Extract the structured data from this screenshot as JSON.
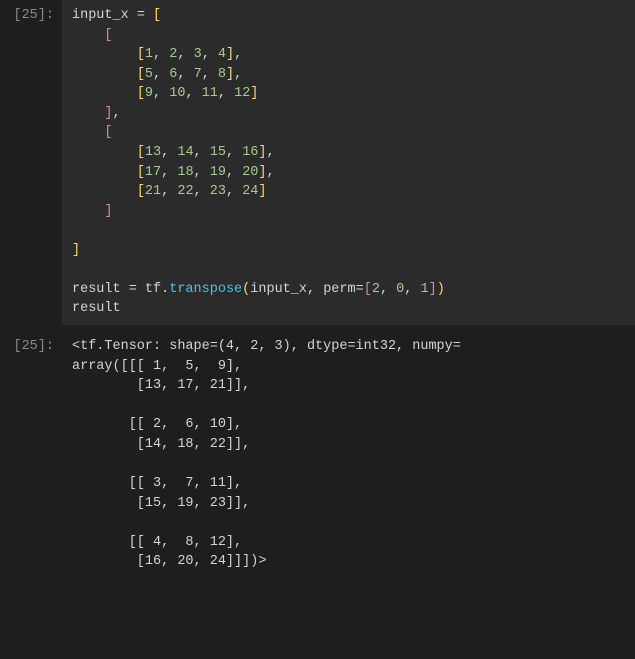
{
  "input_prompt": "[25]:",
  "output_prompt": "[25]:",
  "code": {
    "var_input": "input_x",
    "eq": " = ",
    "lb": "[",
    "rb": "]",
    "lp": "(",
    "rp": ")",
    "comma": ",",
    "sp4": "    ",
    "sp8": "        ",
    "row1": {
      "a": "1",
      "b": "2",
      "c": "3",
      "d": "4"
    },
    "row2": {
      "a": "5",
      "b": "6",
      "c": "7",
      "d": "8"
    },
    "row3": {
      "a": "9",
      "b": "10",
      "c": "11",
      "d": "12"
    },
    "row4": {
      "a": "13",
      "b": "14",
      "c": "15",
      "d": "16"
    },
    "row5": {
      "a": "17",
      "b": "18",
      "c": "19",
      "d": "20"
    },
    "row6": {
      "a": "21",
      "b": "22",
      "c": "23",
      "d": "24"
    },
    "var_result": "result",
    "tf": "tf",
    "dot": ".",
    "transpose": "transpose",
    "perm_kw": "perm",
    "perm0": "2",
    "perm1": "0",
    "perm2": "1"
  },
  "output_text": "<tf.Tensor: shape=(4, 2, 3), dtype=int32, numpy=\narray([[[ 1,  5,  9],\n        [13, 17, 21]],\n\n       [[ 2,  6, 10],\n        [14, 18, 22]],\n\n       [[ 3,  7, 11],\n        [15, 19, 23]],\n\n       [[ 4,  8, 12],\n        [16, 20, 24]]])>",
  "chart_data": {
    "type": "table",
    "input_tensor_shape": [
      2,
      3,
      4
    ],
    "input_tensor": [
      [
        [
          1,
          2,
          3,
          4
        ],
        [
          5,
          6,
          7,
          8
        ],
        [
          9,
          10,
          11,
          12
        ]
      ],
      [
        [
          13,
          14,
          15,
          16
        ],
        [
          17,
          18,
          19,
          20
        ],
        [
          21,
          22,
          23,
          24
        ]
      ]
    ],
    "operation": "tf.transpose",
    "perm": [
      2,
      0,
      1
    ],
    "output_shape": [
      4,
      2,
      3
    ],
    "output_tensor": [
      [
        [
          1,
          5,
          9
        ],
        [
          13,
          17,
          21
        ]
      ],
      [
        [
          2,
          6,
          10
        ],
        [
          14,
          18,
          22
        ]
      ],
      [
        [
          3,
          7,
          11
        ],
        [
          15,
          19,
          23
        ]
      ],
      [
        [
          4,
          8,
          12
        ],
        [
          16,
          20,
          24
        ]
      ]
    ]
  }
}
